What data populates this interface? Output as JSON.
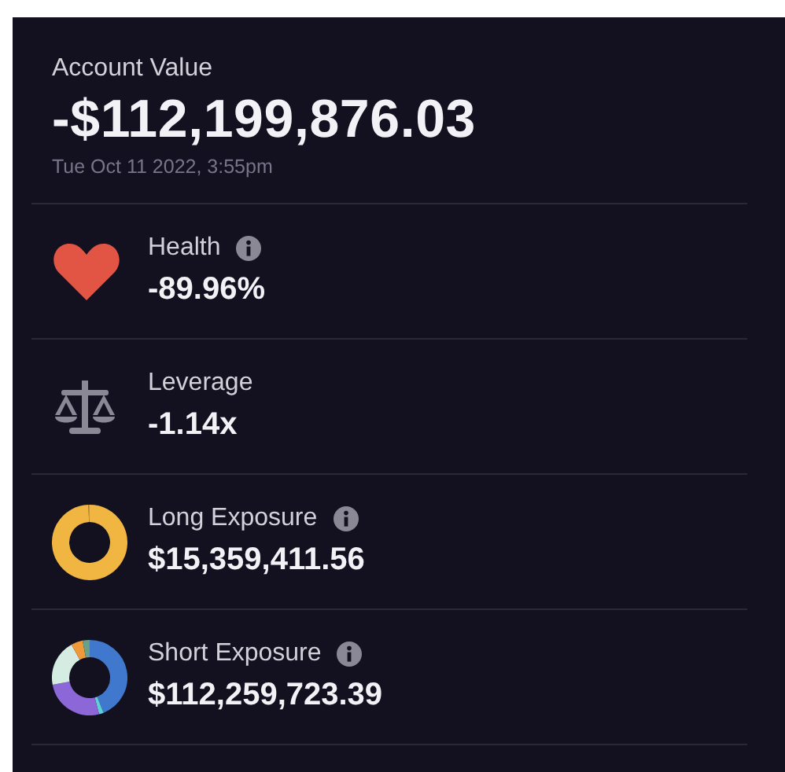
{
  "account": {
    "label": "Account Value",
    "value": "-$112,199,876.03",
    "timestamp": "Tue Oct 11 2022, 3:55pm"
  },
  "stats": [
    {
      "kind": "health",
      "label": "Health",
      "info": true,
      "value": "-89.96%"
    },
    {
      "kind": "leverage",
      "label": "Leverage",
      "info": false,
      "value": "-1.14x"
    },
    {
      "kind": "long",
      "label": "Long Exposure",
      "info": true,
      "value": "$15,359,411.56"
    },
    {
      "kind": "short",
      "label": "Short Exposure",
      "info": true,
      "value": "$112,259,723.39"
    }
  ]
}
